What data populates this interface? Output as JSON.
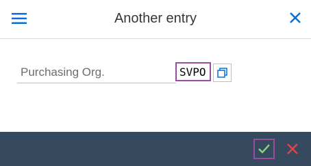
{
  "dialog": {
    "title": "Another entry"
  },
  "form": {
    "field_label": "Purchasing Org.",
    "field_value": "SVPO"
  },
  "icons": {
    "menu": "hamburger-menu-icon",
    "close": "close-icon",
    "value_help": "copy-icon",
    "confirm": "checkmark-icon",
    "cancel": "cancel-x-icon"
  },
  "colors": {
    "accent_blue": "#0a6ed1",
    "focus_purple": "#9b4c9e",
    "footer_bg": "#354a5f",
    "confirm_green": "#8bd17b",
    "cancel_red": "#e04646"
  }
}
